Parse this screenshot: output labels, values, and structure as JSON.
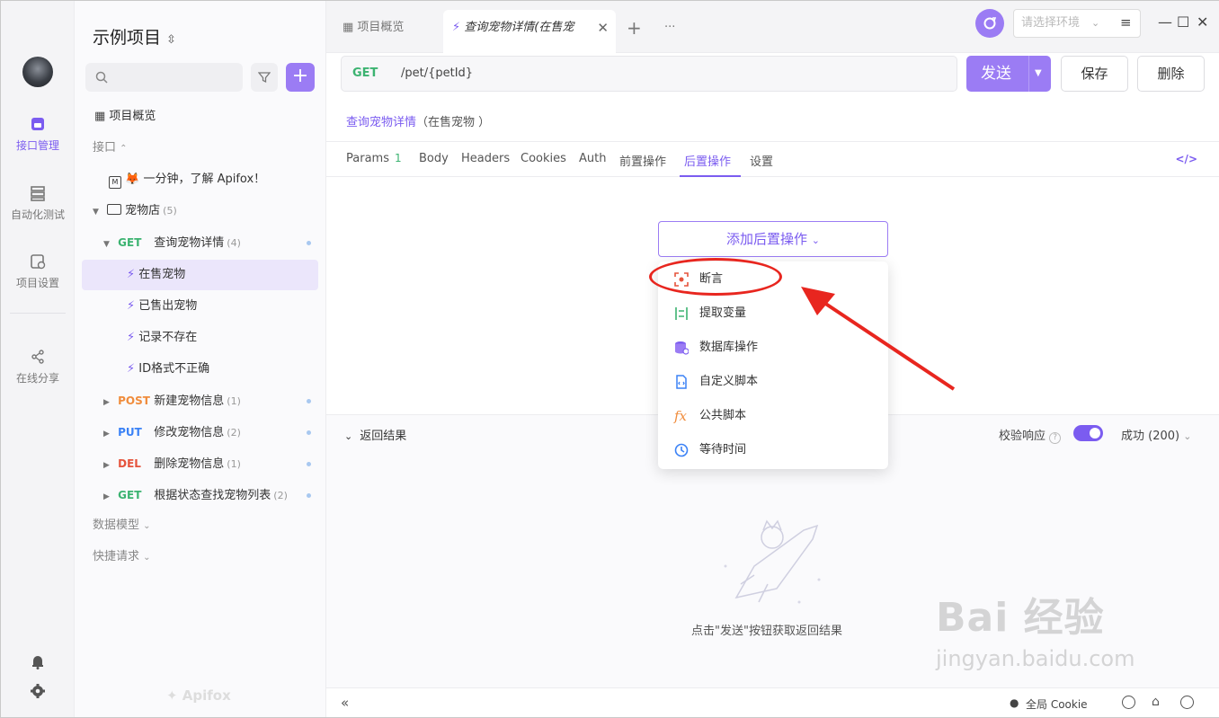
{
  "rail": {
    "items": [
      {
        "label": "接口管理",
        "icon": "api-icon",
        "active": true
      },
      {
        "label": "自动化测试",
        "icon": "automation-icon"
      },
      {
        "label": "项目设置",
        "icon": "project-settings-icon"
      },
      {
        "label": "在线分享",
        "icon": "share-icon"
      }
    ]
  },
  "sidebar": {
    "project_title": "示例项目",
    "project_switch_icon": "⌃",
    "overview": "项目概览",
    "group_interfaces": "接口",
    "intro_doc": "🦊 一分钟，了解 Apifox！",
    "folder": {
      "label": "宠物店",
      "count": "(5)"
    },
    "endpoints": [
      {
        "method": "GET",
        "label": "查询宠物详情",
        "count": "(4)"
      },
      {
        "method": "POST",
        "label": "新建宠物信息",
        "count": "(1)"
      },
      {
        "method": "PUT",
        "label": "修改宠物信息",
        "count": "(2)"
      },
      {
        "method": "DEL",
        "label": "删除宠物信息",
        "count": "(1)"
      },
      {
        "method": "GET",
        "label": "根据状态查找宠物列表",
        "count": "(2)"
      }
    ],
    "cases": [
      "在售宠物",
      "已售出宠物",
      "记录不存在",
      "ID格式不正确"
    ],
    "group_models": "数据模型",
    "group_quick": "快捷请求",
    "brand": "Apifox"
  },
  "tabs": [
    {
      "label": "项目概览"
    },
    {
      "label": "查询宠物详情(在售宠"
    }
  ],
  "env": {
    "placeholder": "请选择环境"
  },
  "request": {
    "method": "GET",
    "path": "/pet/{petId}",
    "send_label": "发送",
    "save_label": "保存",
    "delete_label": "删除",
    "breadcrumb_link": "查询宠物详情",
    "breadcrumb_rest": "（在售宠物 ）"
  },
  "subtabs": [
    {
      "label": "Params",
      "badge": "1"
    },
    {
      "label": "Body"
    },
    {
      "label": "Headers"
    },
    {
      "label": "Cookies"
    },
    {
      "label": "Auth"
    },
    {
      "label": "前置操作"
    },
    {
      "label": "后置操作",
      "active": true
    },
    {
      "label": "设置"
    }
  ],
  "add_post_label": "添加后置操作",
  "dropdown": [
    {
      "label": "断言",
      "icon": "assert-icon",
      "color": "#e5533c"
    },
    {
      "label": "提取变量",
      "icon": "extract-variable-icon",
      "color": "#3cb371"
    },
    {
      "label": "数据库操作",
      "icon": "database-icon",
      "color": "#7b5cf0"
    },
    {
      "label": "自定义脚本",
      "icon": "custom-script-icon",
      "color": "#3b82f6"
    },
    {
      "label": "公共脚本",
      "icon": "fx-icon",
      "color": "#f08c3c"
    },
    {
      "label": "等待时间",
      "icon": "clock-icon",
      "color": "#3b82f6"
    }
  ],
  "result": {
    "title": "返回结果",
    "validate_label": "校验响应",
    "status_label": "成功 (200)",
    "empty_hint": "点击\"发送\"按钮获取返回结果"
  },
  "footer": {
    "cookie_label": "全局 Cookie"
  },
  "watermark": {
    "brand": "Bai 经验",
    "url": "jingyan.baidu.com"
  },
  "colors": {
    "accent": "#7b5cf0",
    "annotation": "#e8261f"
  }
}
